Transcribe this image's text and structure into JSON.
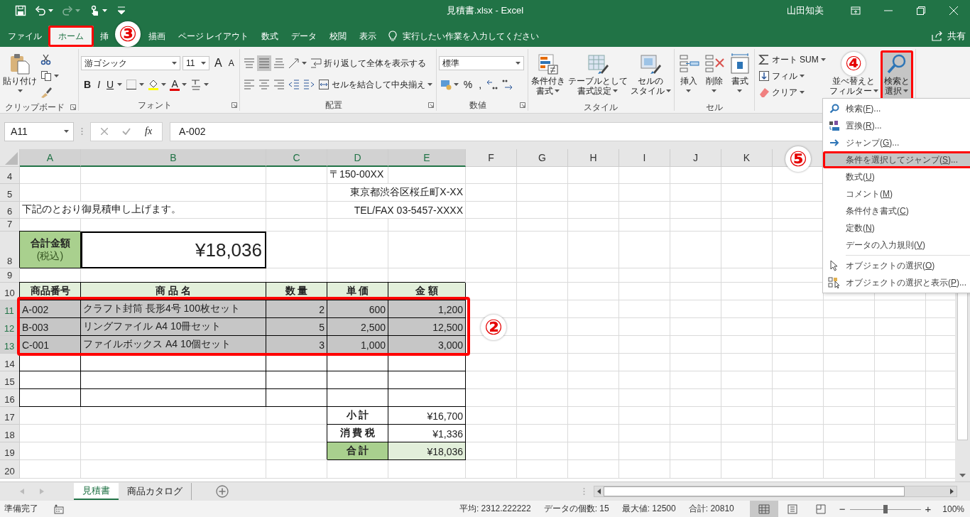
{
  "window": {
    "title": "見積書.xlsx - Excel",
    "user": "山田知美"
  },
  "quick_access": [
    {
      "kind": "save",
      "disabled": false
    },
    {
      "kind": "undo",
      "disabled": false,
      "caret": true
    },
    {
      "kind": "redo",
      "disabled": true,
      "caret": true
    },
    {
      "kind": "touch",
      "disabled": false,
      "caret": true
    },
    {
      "kind": "customize",
      "disabled": false
    }
  ],
  "tabs": [
    {
      "label": "ファイル",
      "selected": false
    },
    {
      "label": "ホーム",
      "selected": true
    },
    {
      "label": "挿",
      "selected": false
    },
    {
      "label": "描画",
      "selected": false
    },
    {
      "label": "ページ レイアウト",
      "selected": false
    },
    {
      "label": "数式",
      "selected": false
    },
    {
      "label": "データ",
      "selected": false
    },
    {
      "label": "校閲",
      "selected": false
    },
    {
      "label": "表示",
      "selected": false
    }
  ],
  "tell_me": {
    "placeholder": "実行したい作業を入力してください"
  },
  "share": "共有",
  "ribbon": {
    "groups": [
      {
        "label": "クリップボード",
        "launcher": true,
        "blocks": [
          {
            "kind": "large",
            "lines": [
              "貼り付け"
            ],
            "caret": true,
            "pressed": false
          },
          {
            "kind": "stack",
            "toolbars": [
              {
                "controls": [
                  {
                    "kind": "icon",
                    "pressed": false
                  }
                ]
              },
              {
                "controls": [
                  {
                    "kind": "icon",
                    "caret": true,
                    "pressed": false
                  }
                ]
              },
              {
                "controls": [
                  {
                    "kind": "icon",
                    "pressed": false
                  }
                ]
              }
            ]
          }
        ]
      },
      {
        "label": "フォント",
        "launcher": true,
        "blocks": [
          {
            "kind": "stack",
            "toolbars": [
              {
                "controls": [
                  {
                    "kind": "combo",
                    "value": "游ゴシック"
                  },
                  {
                    "kind": "combo",
                    "value": "11"
                  },
                  {
                    "kind": "glyph-grow",
                    "text": "A",
                    "pressed": false
                  },
                  {
                    "kind": "glyph-shrink",
                    "text": "A",
                    "pressed": false
                  }
                ]
              },
              {
                "controls": [
                  {
                    "kind": "glyph-bold",
                    "text": "B",
                    "pressed": false
                  },
                  {
                    "kind": "glyph-italic",
                    "text": "I",
                    "pressed": false
                  },
                  {
                    "kind": "glyph-underline",
                    "text": "U",
                    "caret": true,
                    "pressed": false
                  },
                  {
                    "kind": "icon",
                    "caret": true,
                    "pressed": false
                  },
                  {
                    "kind": "icon",
                    "caret": true,
                    "pressed": false
                  },
                  {
                    "kind": "glyph-color",
                    "text": "A",
                    "color": "#e00000",
                    "caret": true,
                    "pressed": false
                  },
                  {
                    "kind": "icon",
                    "caret": true,
                    "pressed": false
                  }
                ]
              }
            ]
          }
        ]
      },
      {
        "label": "配置",
        "launcher": true,
        "blocks": [
          {
            "kind": "stack",
            "toolbars": [
              {
                "controls": [
                  {
                    "kind": "icon",
                    "pressed": false
                  },
                  {
                    "kind": "icon",
                    "pressed": true
                  },
                  {
                    "kind": "icon",
                    "pressed": false
                  },
                  {
                    "kind": "icon",
                    "caret": true,
                    "pressed": false
                  },
                  {
                    "kind": "small",
                    "label": "折り返して全体を表示する",
                    "pressed": false
                  }
                ]
              },
              {
                "controls": [
                  {
                    "kind": "icon",
                    "pressed": false
                  },
                  {
                    "kind": "icon",
                    "pressed": false
                  },
                  {
                    "kind": "icon",
                    "pressed": false
                  },
                  {
                    "kind": "icon",
                    "pressed": false
                  },
                  {
                    "kind": "icon",
                    "pressed": false
                  },
                  {
                    "kind": "small",
                    "label": "セルを結合して中央揃え",
                    "caret": true,
                    "pressed": false
                  }
                ]
              }
            ]
          }
        ]
      },
      {
        "label": "数値",
        "launcher": true,
        "blocks": [
          {
            "kind": "stack",
            "toolbars": [
              {
                "controls": [
                  {
                    "kind": "combo",
                    "value": "標準"
                  }
                ]
              },
              {
                "controls": [
                  {
                    "kind": "icon",
                    "caret": true,
                    "pressed": false
                  },
                  {
                    "kind": "glyph",
                    "text": "%",
                    "pressed": false
                  },
                  {
                    "kind": "glyph",
                    "text": ",",
                    "pressed": false
                  },
                  {
                    "kind": "icon",
                    "pressed": false
                  },
                  {
                    "kind": "icon",
                    "pressed": false
                  }
                ]
              }
            ]
          }
        ]
      },
      {
        "label": "スタイル",
        "blocks": [
          {
            "kind": "large",
            "lines": [
              "条件付き",
              "書式"
            ],
            "caret": true,
            "pressed": false
          },
          {
            "kind": "large",
            "lines": [
              "テーブルとして",
              "書式設定"
            ],
            "caret": true,
            "pressed": false
          },
          {
            "kind": "large",
            "lines": [
              "セルの",
              "スタイル"
            ],
            "caret": true,
            "pressed": false
          }
        ]
      },
      {
        "label": "セル",
        "blocks": [
          {
            "kind": "large",
            "lines": [
              "挿入"
            ],
            "caret": true,
            "pressed": false
          },
          {
            "kind": "large",
            "lines": [
              "削除"
            ],
            "caret": true,
            "pressed": false
          },
          {
            "kind": "large",
            "lines": [
              "書式"
            ],
            "caret": true,
            "pressed": false
          }
        ]
      },
      {
        "blocks": [
          {
            "kind": "stack",
            "toolbars": [
              {
                "controls": [
                  {
                    "kind": "small",
                    "label": "オート SUM",
                    "caret": true,
                    "pressed": false
                  }
                ]
              },
              {
                "controls": [
                  {
                    "kind": "small",
                    "label": "フィル",
                    "caret": true,
                    "pressed": false
                  }
                ]
              },
              {
                "controls": [
                  {
                    "kind": "small",
                    "label": "クリア",
                    "caret": true,
                    "pressed": false
                  }
                ]
              }
            ]
          },
          {
            "kind": "large",
            "lines": [
              "並べ替えと",
              "フィルター"
            ],
            "caret": true,
            "pressed": false
          },
          {
            "kind": "large",
            "lines": [
              "検索と",
              "選択"
            ],
            "caret": true,
            "pressed": true
          }
        ]
      }
    ]
  },
  "formula_bar": {
    "name_box": "A11",
    "function_button": "fx",
    "value": "A-002"
  },
  "sheet": {
    "columns": [
      {
        "name": "A",
        "selected": true
      },
      {
        "name": "B",
        "selected": true
      },
      {
        "name": "C",
        "selected": true
      },
      {
        "name": "D",
        "selected": true
      },
      {
        "name": "E",
        "selected": true
      },
      {
        "name": "F",
        "selected": false
      },
      {
        "name": "G",
        "selected": false
      },
      {
        "name": "H",
        "selected": false
      },
      {
        "name": "I",
        "selected": false
      },
      {
        "name": "J",
        "selected": false
      },
      {
        "name": "K",
        "selected": false
      }
    ],
    "rows": [
      {
        "number": "4",
        "selected": false,
        "cells": {
          "D": {
            "kind": "text",
            "text": "〒150-00XX"
          }
        }
      },
      {
        "number": "5",
        "selected": false,
        "cells": {
          "E": {
            "kind": "spill-right",
            "text": "東京都渋谷区桜丘町X-XX"
          }
        }
      },
      {
        "number": "6",
        "selected": false,
        "cells": {
          "A": {
            "kind": "spill",
            "text": "下記のとおり御見積申し上げます。"
          },
          "E": {
            "kind": "spill-right",
            "text": "TEL/FAX 03-5457-XXXX"
          }
        }
      },
      {
        "number": "7",
        "selected": false,
        "cells": {}
      },
      {
        "number": "8",
        "selected": false,
        "cells": {
          "A": {
            "kind": "title",
            "text": "合計金額",
            "note": "(税込)"
          },
          "B": {
            "kind": "big",
            "text": "¥18,036"
          }
        }
      },
      {
        "number": "9",
        "selected": false,
        "cells": {}
      },
      {
        "number": "10",
        "selected": false,
        "cells": {
          "A": {
            "kind": "head",
            "text": "商品番号"
          },
          "B": {
            "kind": "head",
            "text": "商 品 名"
          },
          "C": {
            "kind": "head",
            "text": "数 量"
          },
          "D": {
            "kind": "head",
            "text": "単 価"
          },
          "E": {
            "kind": "head",
            "text": "金 額"
          }
        }
      },
      {
        "number": "11",
        "selected": true,
        "cells": {
          "A": {
            "kind": "cell",
            "text": "A-002"
          },
          "B": {
            "kind": "cell",
            "text": "クラフト封筒 長形4号 100枚セット"
          },
          "C": {
            "kind": "num",
            "text": "2"
          },
          "D": {
            "kind": "num",
            "text": "600"
          },
          "E": {
            "kind": "num",
            "text": "1,200"
          }
        }
      },
      {
        "number": "12",
        "selected": true,
        "cells": {
          "A": {
            "kind": "cell",
            "text": "B-003"
          },
          "B": {
            "kind": "cell",
            "text": "リングファイル A4 10冊セット"
          },
          "C": {
            "kind": "num",
            "text": "5"
          },
          "D": {
            "kind": "num",
            "text": "2,500"
          },
          "E": {
            "kind": "num",
            "text": "12,500"
          }
        }
      },
      {
        "number": "13",
        "selected": true,
        "cells": {
          "A": {
            "kind": "cell",
            "text": "C-001"
          },
          "B": {
            "kind": "cell",
            "text": "ファイルボックス A4 10個セット"
          },
          "C": {
            "kind": "num",
            "text": "3"
          },
          "D": {
            "kind": "num",
            "text": "1,000"
          },
          "E": {
            "kind": "num",
            "text": "3,000"
          }
        }
      },
      {
        "number": "14",
        "selected": false,
        "cells": {
          "A": {
            "kind": "box"
          },
          "B": {
            "kind": "box"
          },
          "C": {
            "kind": "box"
          },
          "D": {
            "kind": "box"
          },
          "E": {
            "kind": "box"
          }
        }
      },
      {
        "number": "15",
        "selected": false,
        "cells": {
          "A": {
            "kind": "box"
          },
          "B": {
            "kind": "box"
          },
          "C": {
            "kind": "box"
          },
          "D": {
            "kind": "box"
          },
          "E": {
            "kind": "box"
          }
        }
      },
      {
        "number": "16",
        "selected": false,
        "cells": {
          "A": {
            "kind": "box"
          },
          "B": {
            "kind": "box"
          },
          "C": {
            "kind": "box"
          },
          "D": {
            "kind": "box"
          },
          "E": {
            "kind": "box"
          }
        }
      },
      {
        "number": "17",
        "selected": false,
        "cells": {
          "D": {
            "kind": "label",
            "text": "小 計"
          },
          "E": {
            "kind": "num",
            "text": "¥16,700"
          }
        }
      },
      {
        "number": "18",
        "selected": false,
        "cells": {
          "D": {
            "kind": "label",
            "text": "消 費 税"
          },
          "E": {
            "kind": "num",
            "text": "¥1,336"
          }
        }
      },
      {
        "number": "19",
        "selected": false,
        "cells": {
          "D": {
            "kind": "label-fill",
            "text": "合 計"
          },
          "E": {
            "kind": "num-fill",
            "text": "¥18,036"
          }
        }
      },
      {
        "number": "20",
        "selected": false,
        "cells": {}
      }
    ]
  },
  "menu": {
    "sections": [
      {
        "items": [
          {
            "label": "検索(",
            "key": "F",
            "rest": ")...",
            "selected": false
          },
          {
            "label": "置換(",
            "key": "R",
            "rest": ")...",
            "selected": false
          },
          {
            "label": "ジャンプ(",
            "key": "G",
            "rest": ")...",
            "selected": false
          },
          {
            "label": "条件を選択してジャンプ(",
            "key": "S",
            "rest": ")...",
            "selected": true
          },
          {
            "label": "数式(",
            "key": "U",
            "rest": ")",
            "selected": false
          },
          {
            "label": "コメント(",
            "key": "M",
            "rest": ")",
            "selected": false
          },
          {
            "label": "条件付き書式(",
            "key": "C",
            "rest": ")",
            "selected": false
          },
          {
            "label": "定数(",
            "key": "N",
            "rest": ")",
            "selected": false
          },
          {
            "label": "データの入力規則(",
            "key": "V",
            "rest": ")",
            "selected": false
          }
        ]
      },
      {
        "items": [
          {
            "label": "オブジェクトの選択(",
            "key": "O",
            "rest": ")",
            "selected": false
          },
          {
            "label": "オブジェクトの選択と表示(",
            "key": "P",
            "rest": ")...",
            "selected": false
          }
        ]
      }
    ]
  },
  "annotations": [
    {
      "label": "③"
    },
    {
      "label": "④"
    },
    {
      "label": "⑤"
    },
    {
      "label": "②"
    }
  ],
  "sheet_tabs": [
    {
      "label": "見積書",
      "selected": true
    },
    {
      "label": "商品カタログ",
      "selected": false
    }
  ],
  "status_bar": {
    "mode": "準備完了",
    "stats": [
      "平均: 2312.222222",
      "データの個数: 15",
      "最大値: 12500",
      "合計: 20810"
    ],
    "views": [
      {
        "selected": true
      },
      {
        "selected": false
      },
      {
        "selected": false
      }
    ],
    "zoom": {
      "minus": "−",
      "plus": "+",
      "level": 0.5,
      "reading": "100%"
    }
  }
}
